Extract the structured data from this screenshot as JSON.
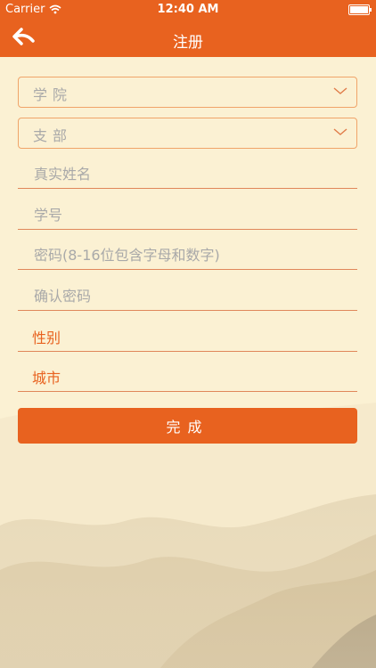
{
  "status_bar": {
    "carrier": "Carrier",
    "time": "12:40 AM"
  },
  "nav": {
    "title": "注册",
    "back_icon": "back-arrow-icon"
  },
  "form": {
    "college_select": {
      "label": "学院",
      "icon": "chevron-down-icon"
    },
    "branch_select": {
      "label": "支部",
      "icon": "chevron-down-icon"
    },
    "name_placeholder": "真实姓名",
    "student_id_placeholder": "学号",
    "password_placeholder": "密码(8-16位包含字母和数字)",
    "confirm_password_placeholder": "确认密码",
    "gender_label": "性别",
    "city_label": "城市",
    "done_label": "完成"
  },
  "colors": {
    "accent": "#e8621f",
    "background": "#fbf1d3",
    "placeholder": "#a9a9a9"
  }
}
